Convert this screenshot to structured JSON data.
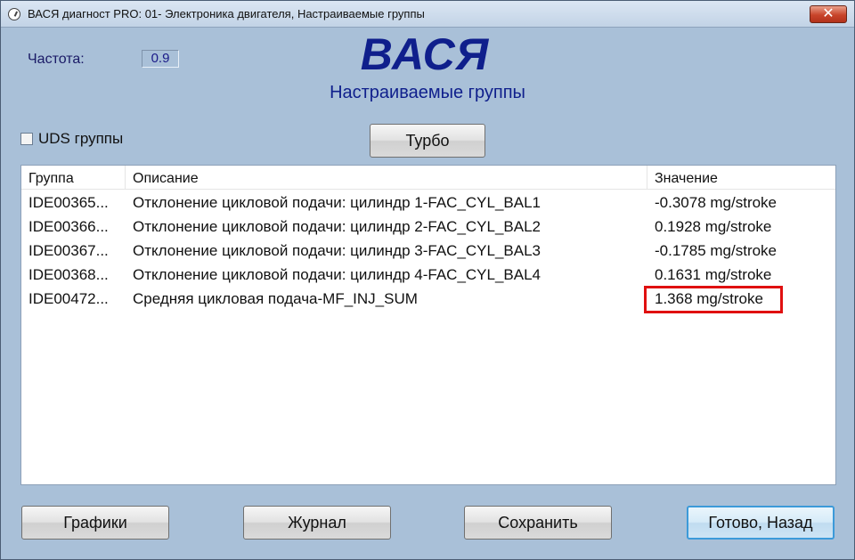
{
  "window": {
    "title": "ВАСЯ диагност PRO: 01- Электроника двигателя,  Настраиваемые группы",
    "close_symbol": "✕"
  },
  "frequency": {
    "label": "Частота:",
    "value": "0.9"
  },
  "brand": "ВАСЯ",
  "subtitle": "Настраиваемые группы",
  "uds": {
    "label": "UDS группы",
    "checked": false
  },
  "buttons": {
    "turbo": "Турбо",
    "graphs": "Графики",
    "log": "Журнал",
    "save": "Сохранить",
    "done": "Готово, Назад"
  },
  "table": {
    "columns": [
      "Группа",
      "Описание",
      "Значение"
    ],
    "rows": [
      {
        "group": "IDE00365...",
        "description": "Отклонение цикловой подачи: цилиндр 1-FAC_CYL_BAL1",
        "value": "-0.3078 mg/stroke"
      },
      {
        "group": "IDE00366...",
        "description": "Отклонение цикловой подачи: цилиндр 2-FAC_CYL_BAL2",
        "value": "0.1928 mg/stroke"
      },
      {
        "group": "IDE00367...",
        "description": "Отклонение цикловой подачи: цилиндр 3-FAC_CYL_BAL3",
        "value": "-0.1785 mg/stroke"
      },
      {
        "group": "IDE00368...",
        "description": "Отклонение цикловой подачи: цилиндр 4-FAC_CYL_BAL4",
        "value": "0.1631 mg/stroke"
      },
      {
        "group": "IDE00472...",
        "description": "Средняя цикловая подача-MF_INJ_SUM",
        "value": "1.368 mg/stroke"
      }
    ]
  },
  "colors": {
    "highlight": "#e01010",
    "accent": "#0f1f8c",
    "background": "#a9c0d8"
  }
}
